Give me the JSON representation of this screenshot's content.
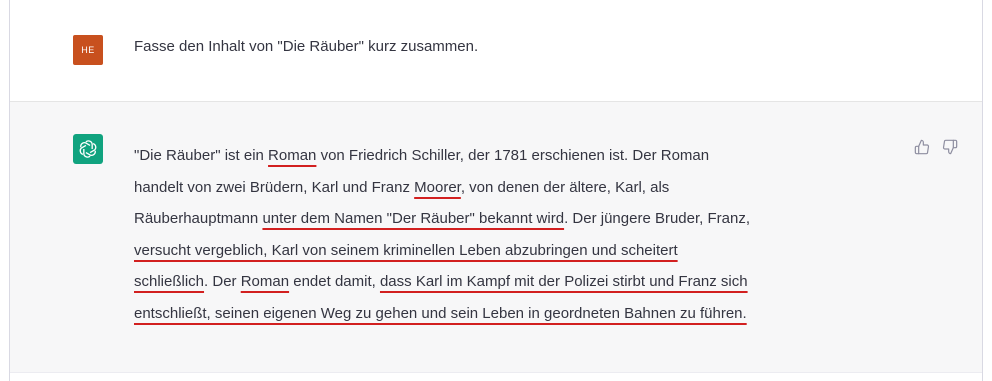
{
  "user_message": {
    "avatar_initials": "HE",
    "text": "Fasse den Inhalt von \"Die Räuber\" kurz zusammen."
  },
  "assistant_message": {
    "lines": [
      [
        {
          "t": "\"Die Räuber\" ist ein ",
          "u": false
        },
        {
          "t": "Roman",
          "u": true
        },
        {
          "t": " von Friedrich Schiller, der 1781 erschienen ist. Der Roman",
          "u": false
        }
      ],
      [
        {
          "t": "handelt von zwei Brüdern, Karl und Franz ",
          "u": false
        },
        {
          "t": "Moorer",
          "u": true
        },
        {
          "t": ", von denen der ältere, Karl, als",
          "u": false
        }
      ],
      [
        {
          "t": "Räuberhauptmann ",
          "u": false
        },
        {
          "t": "unter dem Namen \"Der Räuber\" bekannt wird",
          "u": true
        },
        {
          "t": ". Der jüngere Bruder, Franz,",
          "u": false
        }
      ],
      [
        {
          "t": "versucht vergeblich, Karl von seinem kriminellen Leben abzubringen und scheitert",
          "u": true
        }
      ],
      [
        {
          "t": "schließlich",
          "u": true
        },
        {
          "t": ". Der ",
          "u": false
        },
        {
          "t": "Roman",
          "u": true
        },
        {
          "t": " endet damit, ",
          "u": false
        },
        {
          "t": "dass Karl im Kampf mit der Polizei stirbt und Franz sich",
          "u": true
        }
      ],
      [
        {
          "t": "entschließt, seinen eigenen Weg zu gehen und sein Leben in geordneten Bahnen zu führen.",
          "u": true
        }
      ]
    ]
  },
  "colors": {
    "user_avatar": "#c8501e",
    "assistant_avatar": "#10a37f",
    "underline": "#d22020",
    "assistant_bg": "#f7f7f8"
  },
  "icons": {
    "assistant_avatar": "openai-logo-icon",
    "thumbs_up": "thumbs-up-icon",
    "thumbs_down": "thumbs-down-icon"
  }
}
